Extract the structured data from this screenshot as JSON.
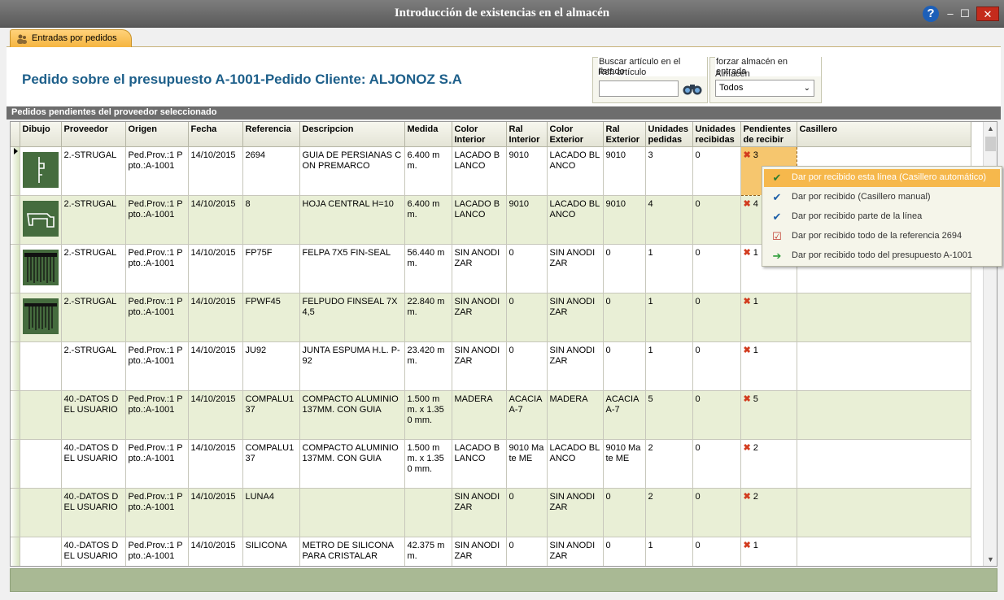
{
  "window": {
    "title": "Introducción de existencias en el almacén",
    "help": "?",
    "minimize": "‒",
    "maximize": "☐",
    "close": "✕"
  },
  "tabs": [
    {
      "label": "Entradas por pedidos"
    }
  ],
  "header": {
    "title": "Pedido sobre el presupuesto A-1001-Pedido Cliente: ALJONOZ S.A"
  },
  "search": {
    "group_label": "Buscar artículo en el listado",
    "field_label": "Ref. artículo",
    "value": ""
  },
  "warehouse": {
    "group_label": "forzar almacén en entrada",
    "field_label": "Almacén",
    "selected": "Todos"
  },
  "grid": {
    "caption": "Pedidos pendientes del proveedor seleccionado",
    "columns": [
      "Dibujo",
      "Proveedor",
      "Origen",
      "Fecha",
      "Referencia",
      "Descripcion",
      "Medida",
      "Color Interior",
      "Ral Interior",
      "Color Exterior",
      "Ral Exterior",
      "Unidades pedidas",
      "Unidades recibidas",
      "Pendientes de recibir",
      "Casillero"
    ],
    "rows": [
      {
        "proveedor": "2.-STRUGAL",
        "origen": "Ped.Prov.:1 Ppto.:A-1001",
        "fecha": "14/10/2015",
        "referencia": "2694",
        "descripcion": "GUIA DE PERSIANAS CON PREMARCO",
        "medida": "6.400 mm.",
        "color_int": "LACADO BLANCO",
        "ral_int": "9010",
        "color_ext": "LACADO BLANCO",
        "ral_ext": "9010",
        "pedidas": "3",
        "recibidas": "0",
        "pendientes": "3",
        "casillero": ""
      },
      {
        "proveedor": "2.-STRUGAL",
        "origen": "Ped.Prov.:1 Ppto.:A-1001",
        "fecha": "14/10/2015",
        "referencia": "8",
        "descripcion": "HOJA CENTRAL H=10",
        "medida": "6.400 mm.",
        "color_int": "LACADO BLANCO",
        "ral_int": "9010",
        "color_ext": "LACADO BLANCO",
        "ral_ext": "9010",
        "pedidas": "4",
        "recibidas": "0",
        "pendientes": "4",
        "casillero": ""
      },
      {
        "proveedor": "2.-STRUGAL",
        "origen": "Ped.Prov.:1 Ppto.:A-1001",
        "fecha": "14/10/2015",
        "referencia": "FP75F",
        "descripcion": "FELPA 7X5 FIN-SEAL",
        "medida": "56.440 mm.",
        "color_int": "SIN ANODIZAR",
        "ral_int": "0",
        "color_ext": "SIN ANODIZAR",
        "ral_ext": "0",
        "pedidas": "1",
        "recibidas": "0",
        "pendientes": "1",
        "casillero": ""
      },
      {
        "proveedor": "2.-STRUGAL",
        "origen": "Ped.Prov.:1 Ppto.:A-1001",
        "fecha": "14/10/2015",
        "referencia": "FPWF45",
        "descripcion": "FELPUDO FINSEAL 7X4,5",
        "medida": "22.840 mm.",
        "color_int": "SIN ANODIZAR",
        "ral_int": "0",
        "color_ext": "SIN ANODIZAR",
        "ral_ext": "0",
        "pedidas": "1",
        "recibidas": "0",
        "pendientes": "1",
        "casillero": ""
      },
      {
        "proveedor": "2.-STRUGAL",
        "origen": "Ped.Prov.:1 Ppto.:A-1001",
        "fecha": "14/10/2015",
        "referencia": "JU92",
        "descripcion": "JUNTA ESPUMA H.L. P-92",
        "medida": "23.420 mm.",
        "color_int": "SIN ANODIZAR",
        "ral_int": "0",
        "color_ext": "SIN ANODIZAR",
        "ral_ext": "0",
        "pedidas": "1",
        "recibidas": "0",
        "pendientes": "1",
        "casillero": ""
      },
      {
        "proveedor": "40.-DATOS DEL USUARIO",
        "origen": "Ped.Prov.:1 Ppto.:A-1001",
        "fecha": "14/10/2015",
        "referencia": "COMPALU137",
        "descripcion": "COMPACTO ALUMINIO 137MM. CON GUIA",
        "medida": "1.500 mm. x 1.350 mm.",
        "color_int": "MADERA",
        "ral_int": "ACACIA A-7",
        "color_ext": "MADERA",
        "ral_ext": "ACACIA A-7",
        "pedidas": "5",
        "recibidas": "0",
        "pendientes": "5",
        "casillero": ""
      },
      {
        "proveedor": "40.-DATOS DEL USUARIO",
        "origen": "Ped.Prov.:1 Ppto.:A-1001",
        "fecha": "14/10/2015",
        "referencia": "COMPALU137",
        "descripcion": "COMPACTO ALUMINIO 137MM. CON GUIA",
        "medida": "1.500 mm. x 1.350 mm.",
        "color_int": "LACADO BLANCO",
        "ral_int": "9010 Mate ME",
        "color_ext": "LACADO BLANCO",
        "ral_ext": "9010 Mate ME",
        "pedidas": "2",
        "recibidas": "0",
        "pendientes": "2",
        "casillero": ""
      },
      {
        "proveedor": "40.-DATOS DEL USUARIO",
        "origen": "Ped.Prov.:1 Ppto.:A-1001",
        "fecha": "14/10/2015",
        "referencia": "LUNA4",
        "descripcion": "",
        "medida": "",
        "color_int": "SIN ANODIZAR",
        "ral_int": "0",
        "color_ext": "SIN ANODIZAR",
        "ral_ext": "0",
        "pedidas": "2",
        "recibidas": "0",
        "pendientes": "2",
        "casillero": ""
      },
      {
        "proveedor": "40.-DATOS DEL USUARIO",
        "origen": "Ped.Prov.:1 Ppto.:A-1001",
        "fecha": "14/10/2015",
        "referencia": "SILICONA",
        "descripcion": "METRO DE SILICONA PARA CRISTALAR",
        "medida": "42.375 mm.",
        "color_int": "SIN ANODIZAR",
        "ral_int": "0",
        "color_ext": "SIN ANODIZAR",
        "ral_ext": "0",
        "pedidas": "1",
        "recibidas": "0",
        "pendientes": "1",
        "casillero": ""
      }
    ]
  },
  "context_menu": [
    {
      "label": "Dar por recibido esta línea (Casillero automático)",
      "icon": "check-icon"
    },
    {
      "label": "Dar por recibido (Casillero manual)",
      "icon": "check-icon"
    },
    {
      "label": "Dar por recibido parte de la línea",
      "icon": "check-icon"
    },
    {
      "label": "Dar por recibido todo de la referencia 2694",
      "icon": "checklist-icon"
    },
    {
      "label": "Dar por recibido todo del presupuesto A-1001",
      "icon": "arrow-right-icon"
    }
  ],
  "colors": {
    "accent": "#f6b84c",
    "title_blue": "#1d5f8a",
    "alt_row": "#e9efd6",
    "statusbar": "#a9b994"
  }
}
